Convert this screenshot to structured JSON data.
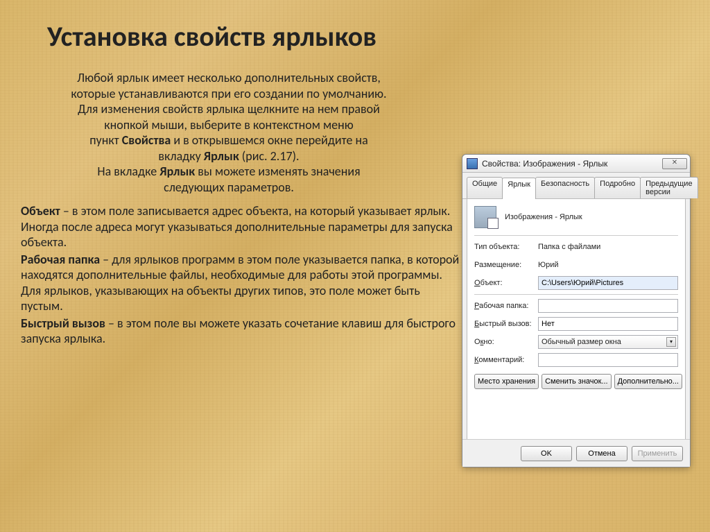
{
  "title": "Установка свойств ярлыков",
  "intro": {
    "l1": "Любой ярлык имеет несколько дополнительных свойств,",
    "l2": "которые устанавливаются при его создании по умолчанию.",
    "l3": "Для изменения свойств ярлыка щелкните на нем правой",
    "l4": "кнопкой мыши, выберите в контекстном меню",
    "l5a": "пункт ",
    "l5b": "Свойства",
    "l5c": " и в открывшемся окне перейдите на",
    "l6a": "вкладку ",
    "l6b": "Ярлык",
    "l6c": " (рис. 2.17).",
    "l7a": "На вкладке ",
    "l7b": "Ярлык",
    "l7c": " вы можете изменять значения",
    "l8": "следующих параметров."
  },
  "body": {
    "p1b": "Объект",
    "p1": " – в этом поле записывается адрес объекта, на который указывает ярлык. Иногда после адреса могут указываться дополнительные параметры для запуска объекта.",
    "p2b": "Рабочая папка",
    "p2": " – для ярлыков программ в этом поле указывается папка, в которой находятся дополнительные файлы, необходимые для работы этой программы. Для ярлыков, указывающих на объекты других типов, это поле может быть пустым.",
    "p3b": " Быстрый вызов",
    "p3": " – в этом поле вы можете указать сочетание клавиш для быстрого запуска ярлыка."
  },
  "dialog": {
    "title": "Свойства: Изображения - Ярлык",
    "close": "✕",
    "tabs": [
      "Общие",
      "Ярлык",
      "Безопасность",
      "Подробно",
      "Предыдущие версии"
    ],
    "header": "Изображения - Ярлык",
    "rows": {
      "type_label": "Тип объекта:",
      "type_value": "Папка с файлами",
      "location_label": "Размещение:",
      "location_value": "Юрий",
      "object_label_u": "О",
      "object_label": "бъект:",
      "object_value": "C:\\Users\\Юрий\\Pictures",
      "workdir_label_u": "Р",
      "workdir_label": "абочая папка:",
      "workdir_value": "",
      "hotkey_label_u": "Б",
      "hotkey_label": "ыстрый вызов:",
      "hotkey_value": "Нет",
      "window_label": "О",
      "window_label2_u": "к",
      "window_label3": "но:",
      "window_value": "Обычный размер окна",
      "comment_label_u": "К",
      "comment_label": "омментарий:",
      "comment_value": ""
    },
    "buttons": {
      "loc": "Место хранения",
      "icon": "Сменить значок...",
      "adv": "Дополнительно..."
    },
    "footer": {
      "ok": "OK",
      "cancel": "Отмена",
      "apply": "Применить"
    }
  }
}
